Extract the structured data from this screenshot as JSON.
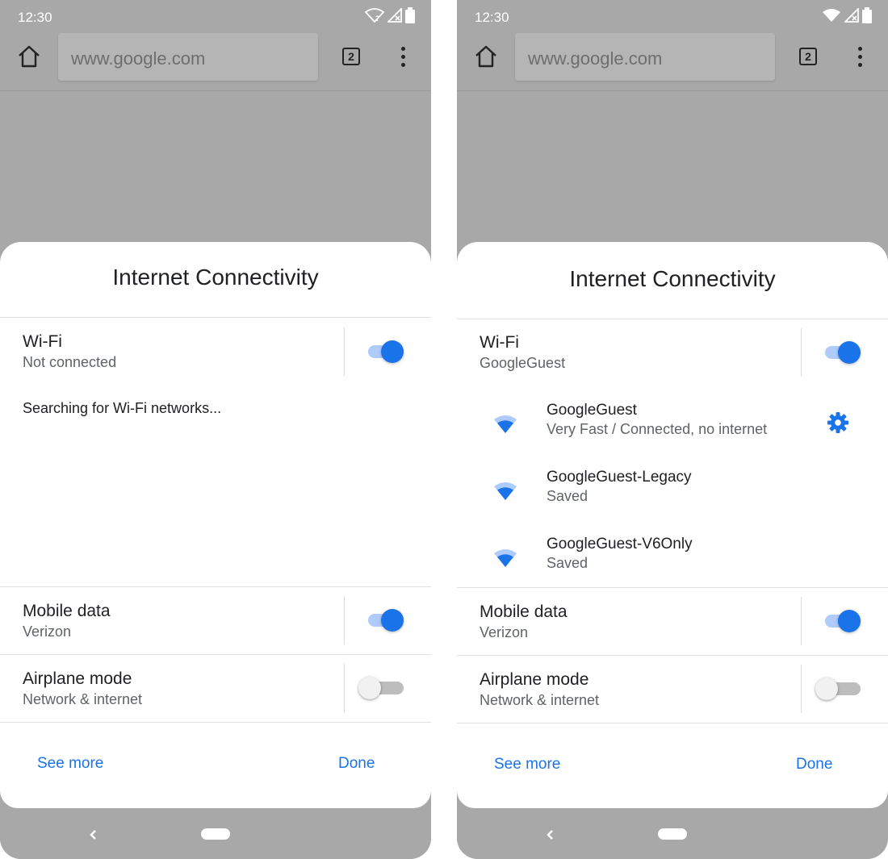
{
  "left": {
    "status_time": "12:30",
    "url": "www.google.com",
    "tab_count": "2",
    "title": "Internet Connectivity",
    "wifi": {
      "title": "Wi-Fi",
      "subtitle": "Not connected",
      "enabled": true
    },
    "searching_text": "Searching for Wi-Fi networks...",
    "mobile": {
      "title": "Mobile data",
      "subtitle": "Verizon",
      "enabled": true
    },
    "airplane": {
      "title": "Airplane mode",
      "subtitle": "Network & internet",
      "enabled": false
    },
    "see_more": "See more",
    "done": "Done"
  },
  "right": {
    "status_time": "12:30",
    "url": "www.google.com",
    "tab_count": "2",
    "title": "Internet Connectivity",
    "wifi": {
      "title": "Wi-Fi",
      "subtitle": "GoogleGuest",
      "enabled": true
    },
    "networks": [
      {
        "name": "GoogleGuest",
        "status": "Very Fast / Connected, no internet",
        "icon": "wifi-icon",
        "has_settings": true
      },
      {
        "name": "GoogleGuest-Legacy",
        "status": "Saved",
        "icon": "wifi-icon",
        "has_settings": false
      },
      {
        "name": "GoogleGuest-V6Only",
        "status": "Saved",
        "icon": "wifi-icon",
        "has_settings": false
      }
    ],
    "mobile": {
      "title": "Mobile data",
      "subtitle": "Verizon",
      "enabled": true
    },
    "airplane": {
      "title": "Airplane mode",
      "subtitle": "Network & internet",
      "enabled": false
    },
    "see_more": "See more",
    "done": "Done"
  },
  "colors": {
    "accent": "#1a73e8",
    "scrim": "#a8a8a8",
    "sheet": "#ffffff"
  }
}
